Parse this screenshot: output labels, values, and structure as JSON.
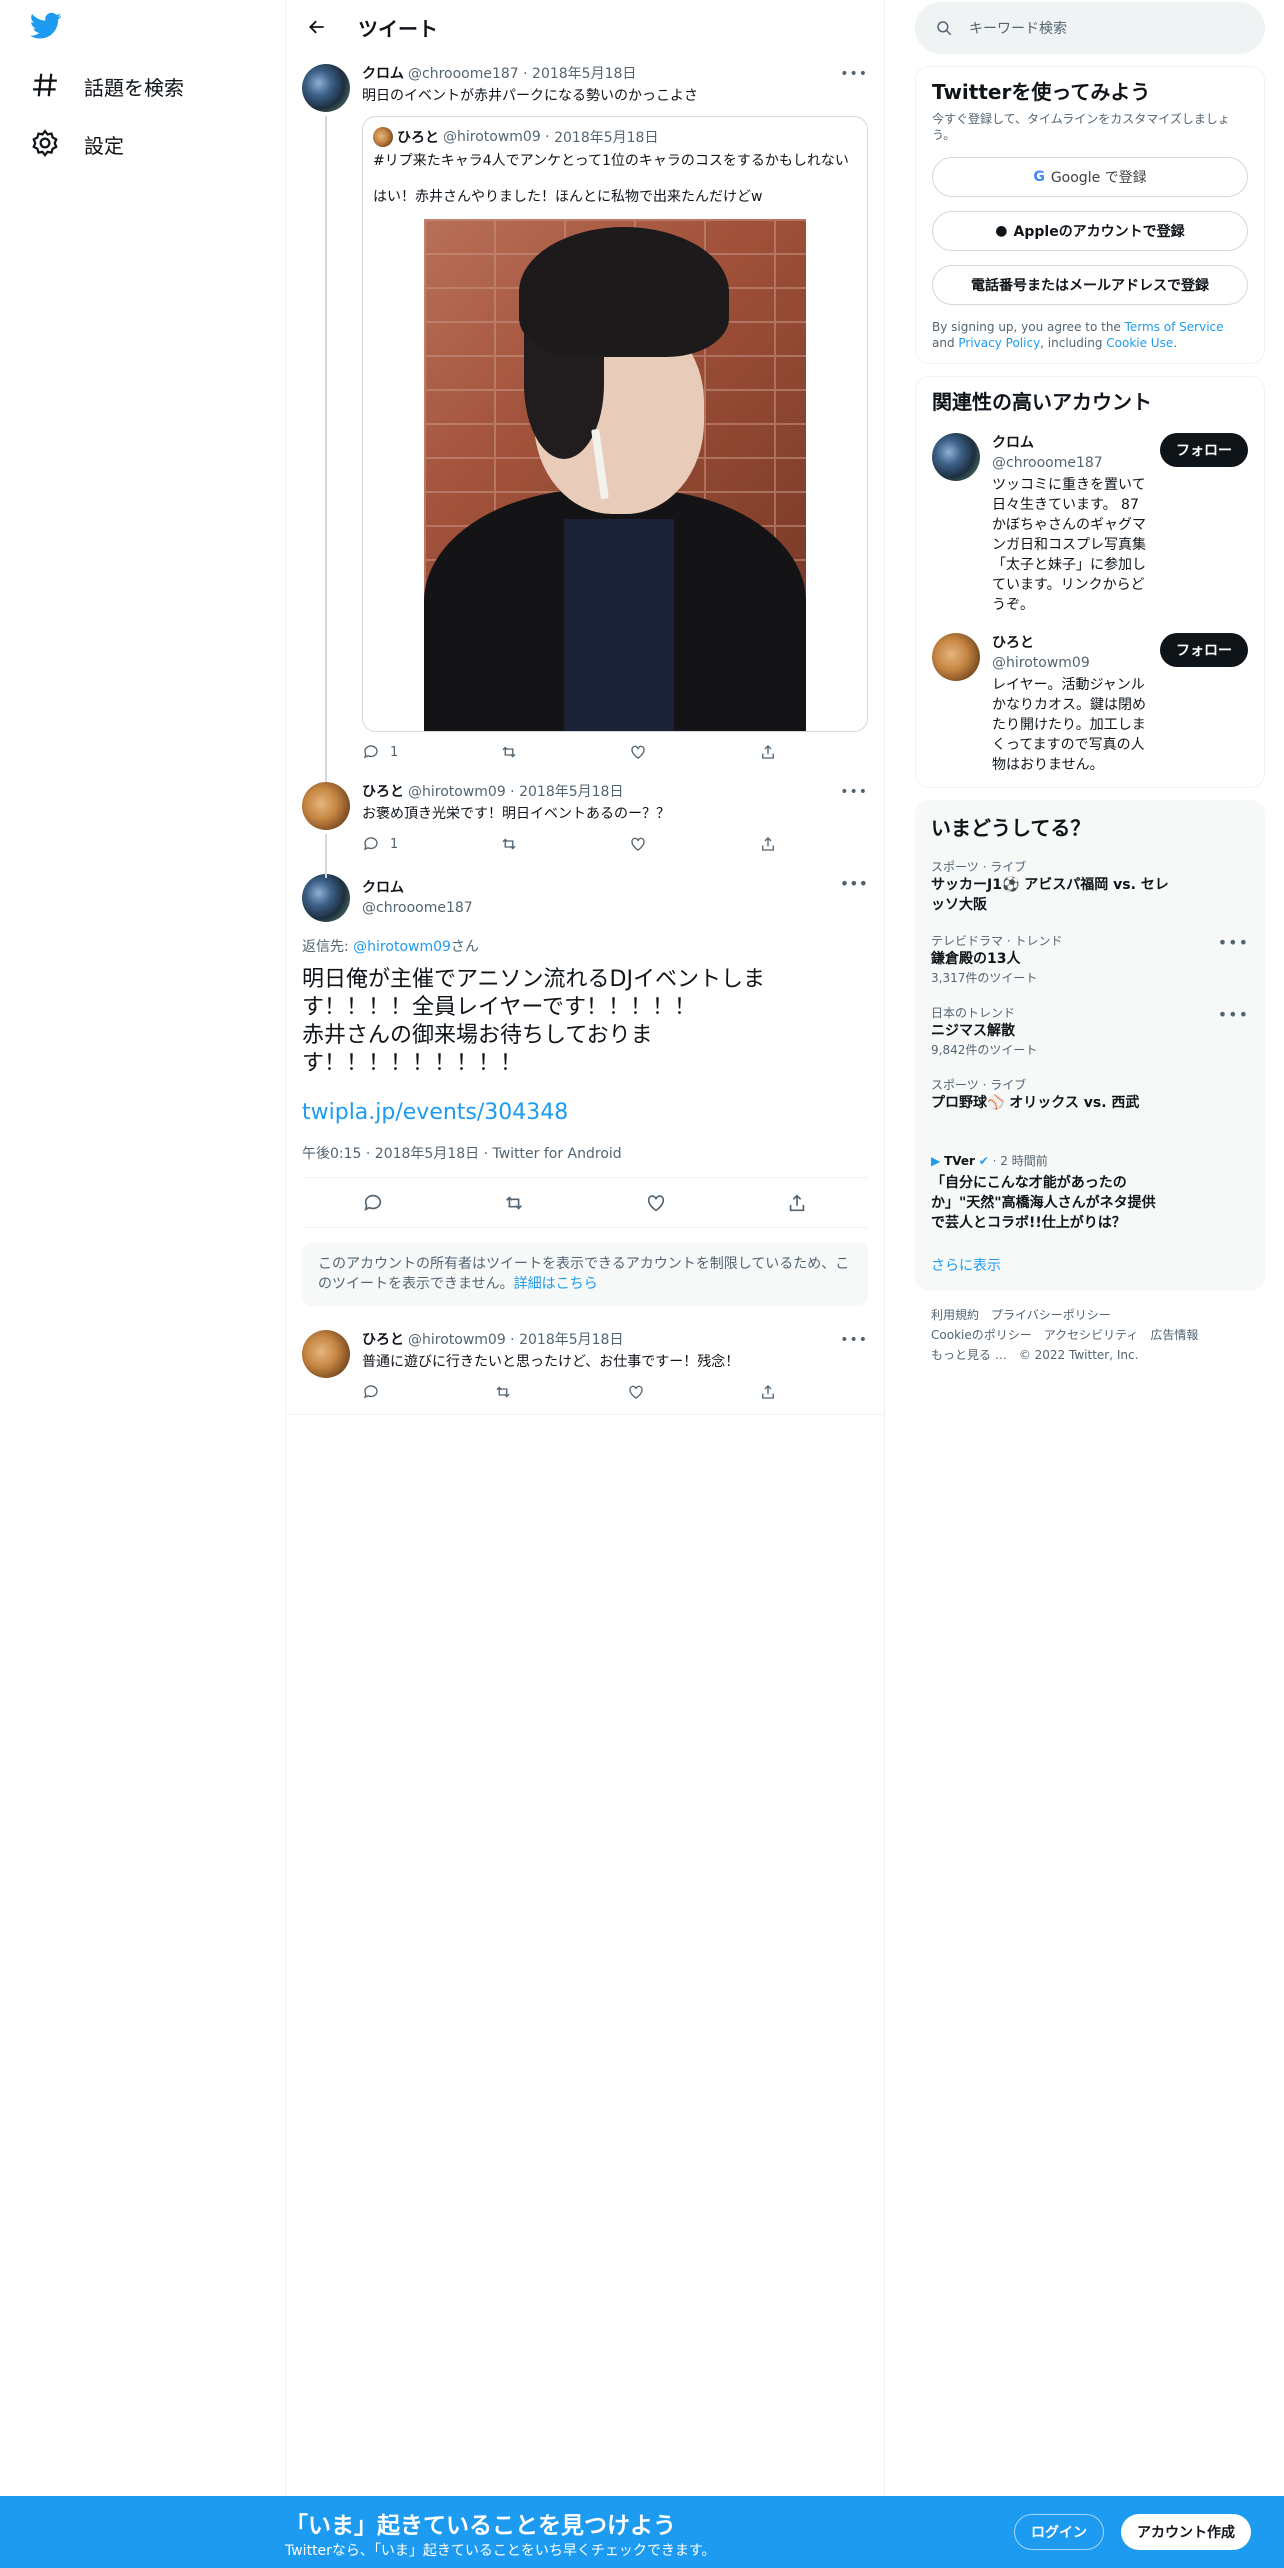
{
  "nav": {
    "explore_label": "話題を検索",
    "settings_label": "設定"
  },
  "header": {
    "title": "ツイート"
  },
  "tweets": [
    {
      "name": "クロム",
      "handle": "@chrooome187",
      "date": "2018年5月18日",
      "text": "明日のイベントが赤井パークになる勢いのかっこよさ",
      "quote": {
        "name": "ひろと",
        "handle": "@hirotowm09",
        "date": "2018年5月18日",
        "text1": "#リプ来たキャラ4人でアンケとって1位のキャラのコスをするかもしれない",
        "text2": "はい！赤井さんやりました！ほんとに私物で出来たんだけどw"
      },
      "reply_count": "1"
    },
    {
      "name": "ひろと",
      "handle": "@hirotowm09",
      "date": "2018年5月18日",
      "text": "お褒め頂き光栄です！明日イベントあるのー？？",
      "reply_count": "1"
    }
  ],
  "focus": {
    "name": "クロム",
    "handle": "@chrooome187",
    "reply_prefix": "返信先: ",
    "reply_handle": "@hirotowm09",
    "reply_suffix": "さん",
    "text": "明日俺が主催でアニソン流れるDJイベントします！！！！全員レイヤーです！！！！！\n赤井さんの御来場お待ちしております！！！！！！！！！",
    "link": "twipla.jp/events/304348",
    "timestamp": "午後0:15 · 2018年5月18日 · Twitter for Android"
  },
  "notice": {
    "text": "このアカウントの所有者はツイートを表示できるアカウントを制限しているため、このツイートを表示できません。",
    "link": "詳細はこちら"
  },
  "reply": {
    "name": "ひろと",
    "handle": "@hirotowm09",
    "date": "2018年5月18日",
    "text": "普通に遊びに行きたいと思ったけど、お仕事ですー！残念！"
  },
  "sidebar": {
    "search_placeholder": "キーワード検索",
    "signup": {
      "title": "Twitterを使ってみよう",
      "subtitle": "今すぐ登録して、タイムラインをカスタマイズしましょう。",
      "google": "Google で登録",
      "apple": "Appleのアカウントで登録",
      "phone": "電話番号またはメールアドレスで登録",
      "legal_1": "By signing up, you agree to the ",
      "tos": "Terms of Service",
      "legal_2": " and ",
      "privacy": "Privacy Policy",
      "legal_3": ", including ",
      "cookie": "Cookie Use",
      "legal_4": "."
    },
    "related": {
      "title": "関連性の高いアカウント",
      "follow_label": "フォロー",
      "accounts": [
        {
          "name": "クロム",
          "handle": "@chrooome187",
          "bio": "ツッコミに重きを置いて日々生きています。 87かぼちゃさんのギャグマンガ日和コスプレ写真集「太子と妹子」に参加しています。リンクからどうぞ。"
        },
        {
          "name": "ひろと",
          "handle": "@hirotowm09",
          "bio": "レイヤー。活動ジャンルかなりカオス。鍵は閉めたり開けたり。加工しまくってますので写真の人物はおりません。"
        }
      ]
    },
    "trends": {
      "title": "いまどうしてる？",
      "items": [
        {
          "category": "スポーツ · ライブ",
          "title": "サッカーJ1⚽ アビスパ福岡 vs. セレッソ大阪",
          "count": ""
        },
        {
          "category": "テレビドラマ · トレンド",
          "title": "鎌倉殿の13人",
          "count": "3,317件のツイート"
        },
        {
          "category": "日本のトレンド",
          "title": "ニジマス解散",
          "count": "9,842件のツイート"
        },
        {
          "category": "スポーツ · ライブ",
          "title": "プロ野球⚾ オリックス vs. 西武",
          "count": ""
        }
      ],
      "news": {
        "source": "TVer",
        "time": "2 時間前",
        "title": "「自分にこんな才能があったのか」\"天然\"高橋海人さんがネタ提供で芸人とコラボ!!仕上がりは？"
      },
      "show_more": "さらに表示"
    },
    "footer": {
      "links": [
        "利用規約",
        "プライバシーポリシー",
        "Cookieのポリシー",
        "アクセシビリティ",
        "広告情報",
        "もっと見る …"
      ],
      "copyright": "© 2022 Twitter, Inc."
    }
  },
  "bottom_bar": {
    "title": "「いま」起きていることを見つけよう",
    "subtitle": "Twitterなら、「いま」起きていることをいち早くチェックできます。",
    "login": "ログイン",
    "signup": "アカウント作成"
  },
  "colors": {
    "brand": "#1d9bf0",
    "text": "#0f1419",
    "muted": "#536471"
  }
}
